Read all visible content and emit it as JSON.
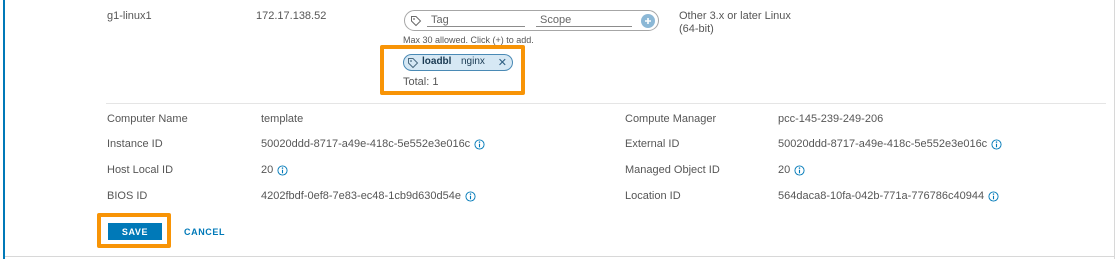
{
  "vm": {
    "name": "g1-linux1",
    "ip": "172.17.138.52",
    "os_line1": "Other 3.x or later Linux",
    "os_line2": "(64-bit)"
  },
  "tag_input": {
    "tag_placeholder": "Tag",
    "scope_placeholder": "Scope",
    "helper": "Max 30 allowed. Click (+) to add."
  },
  "tags": [
    {
      "tag": "loadbl",
      "scope": "nginx"
    }
  ],
  "total": "Total: 1",
  "details": {
    "computer_name_label": "Computer Name",
    "computer_name_value": "template",
    "instance_id_label": "Instance ID",
    "instance_id_value": "50020ddd-8717-a49e-418c-5e552e3e016c",
    "host_local_id_label": "Host Local ID",
    "host_local_id_value": "20",
    "bios_id_label": "BIOS ID",
    "bios_id_value": "4202fbdf-0ef8-7e83-ec48-1cb9d630d54e",
    "compute_manager_label": "Compute Manager",
    "compute_manager_value": "pcc-145-239-249-206",
    "external_id_label": "External ID",
    "external_id_value": "50020ddd-8717-a49e-418c-5e552e3e016c",
    "managed_object_id_label": "Managed Object ID",
    "managed_object_id_value": "20",
    "location_id_label": "Location ID",
    "location_id_value": "564daca8-10fa-042b-771a-776786c40944"
  },
  "actions": {
    "save_label": "SAVE",
    "cancel_label": "CANCEL"
  },
  "colors": {
    "accent": "#0079b8",
    "highlight": "#f89406",
    "chip_bg": "#d6e8f4"
  },
  "icons": [
    "tag-icon",
    "plus-circle-icon",
    "close-icon",
    "info-icon"
  ]
}
